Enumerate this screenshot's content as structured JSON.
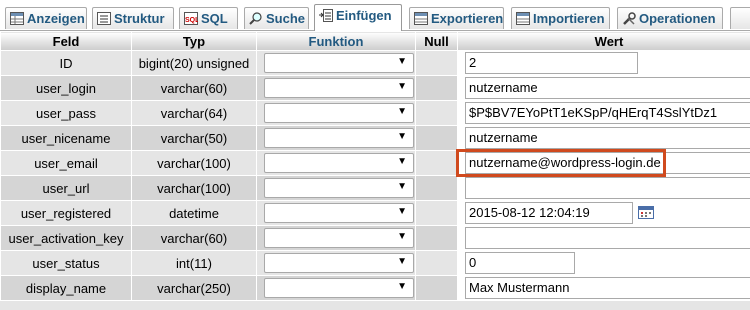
{
  "tabs": [
    {
      "label": "Anzeigen",
      "icon": "table-icon"
    },
    {
      "label": "Struktur",
      "icon": "structure-icon"
    },
    {
      "label": "SQL",
      "icon": "sql-icon"
    },
    {
      "label": "Suche",
      "icon": "search-icon"
    },
    {
      "label": "Einfügen",
      "icon": "insert-icon",
      "active": true
    },
    {
      "label": "Exportieren",
      "icon": "export-icon"
    },
    {
      "label": "Importieren",
      "icon": "import-icon"
    },
    {
      "label": "Operationen",
      "icon": "wrench-icon"
    }
  ],
  "columns": {
    "feld": "Feld",
    "typ": "Typ",
    "funktion": "Funktion",
    "null": "Null",
    "wert": "Wert"
  },
  "rows": [
    {
      "feld": "ID",
      "typ": "bigint(20) unsigned",
      "funktion": "",
      "wert": "2"
    },
    {
      "feld": "user_login",
      "typ": "varchar(60)",
      "funktion": "",
      "wert": "nutzername"
    },
    {
      "feld": "user_pass",
      "typ": "varchar(64)",
      "funktion": "",
      "wert": "$P$BV7EYoPtT1eKSpP/qHErqT4SslYtDz1"
    },
    {
      "feld": "user_nicename",
      "typ": "varchar(50)",
      "funktion": "",
      "wert": "nutzername"
    },
    {
      "feld": "user_email",
      "typ": "varchar(100)",
      "funktion": "",
      "wert": "nutzername@wordpress-login.de"
    },
    {
      "feld": "user_url",
      "typ": "varchar(100)",
      "funktion": "",
      "wert": ""
    },
    {
      "feld": "user_registered",
      "typ": "datetime",
      "funktion": "",
      "wert": "2015-08-12 12:04:19"
    },
    {
      "feld": "user_activation_key",
      "typ": "varchar(60)",
      "funktion": "",
      "wert": ""
    },
    {
      "feld": "user_status",
      "typ": "int(11)",
      "funktion": "",
      "wert": "0"
    },
    {
      "feld": "display_name",
      "typ": "varchar(250)",
      "funktion": "",
      "wert": "Max Mustermann"
    }
  ],
  "select_arrow": "▼",
  "colors": {
    "tab_text": "#235a81",
    "highlight": "#d04a1e",
    "row_odd": "#e5e5e5",
    "row_even": "#d5d5d5"
  }
}
